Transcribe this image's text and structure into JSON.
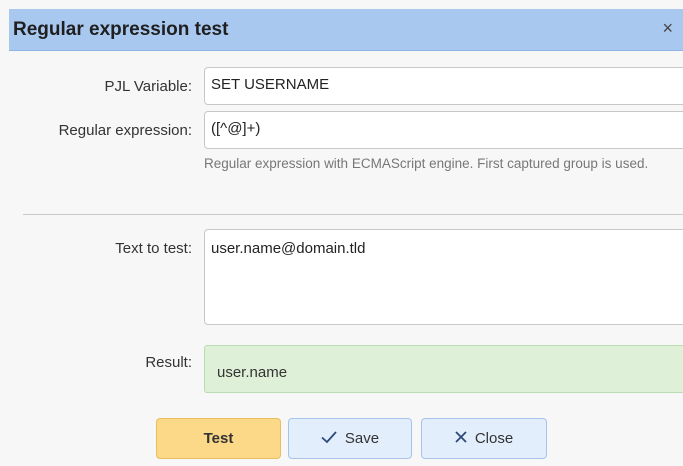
{
  "dialog": {
    "title": "Regular expression test",
    "close_glyph": "×"
  },
  "form": {
    "pjl_label": "PJL Variable:",
    "pjl_value": "SET USERNAME",
    "regex_label": "Regular expression:",
    "regex_value": "([^@]+)",
    "regex_hint": "Regular expression with ECMAScript engine. First captured group is used.",
    "text_label": "Text to test:",
    "text_value": "user.name@domain.tld",
    "result_label": "Result:",
    "result_value": "user.name"
  },
  "buttons": {
    "test_label": "Test",
    "save_label": "Save",
    "save_icon": "check-icon",
    "close_label": "Close",
    "close_icon": "x-icon"
  },
  "colors": {
    "titlebar": "#a9c8f0",
    "test_button": "#fcd889",
    "secondary_button": "#e3eefc",
    "result_background": "#dff0d8"
  }
}
